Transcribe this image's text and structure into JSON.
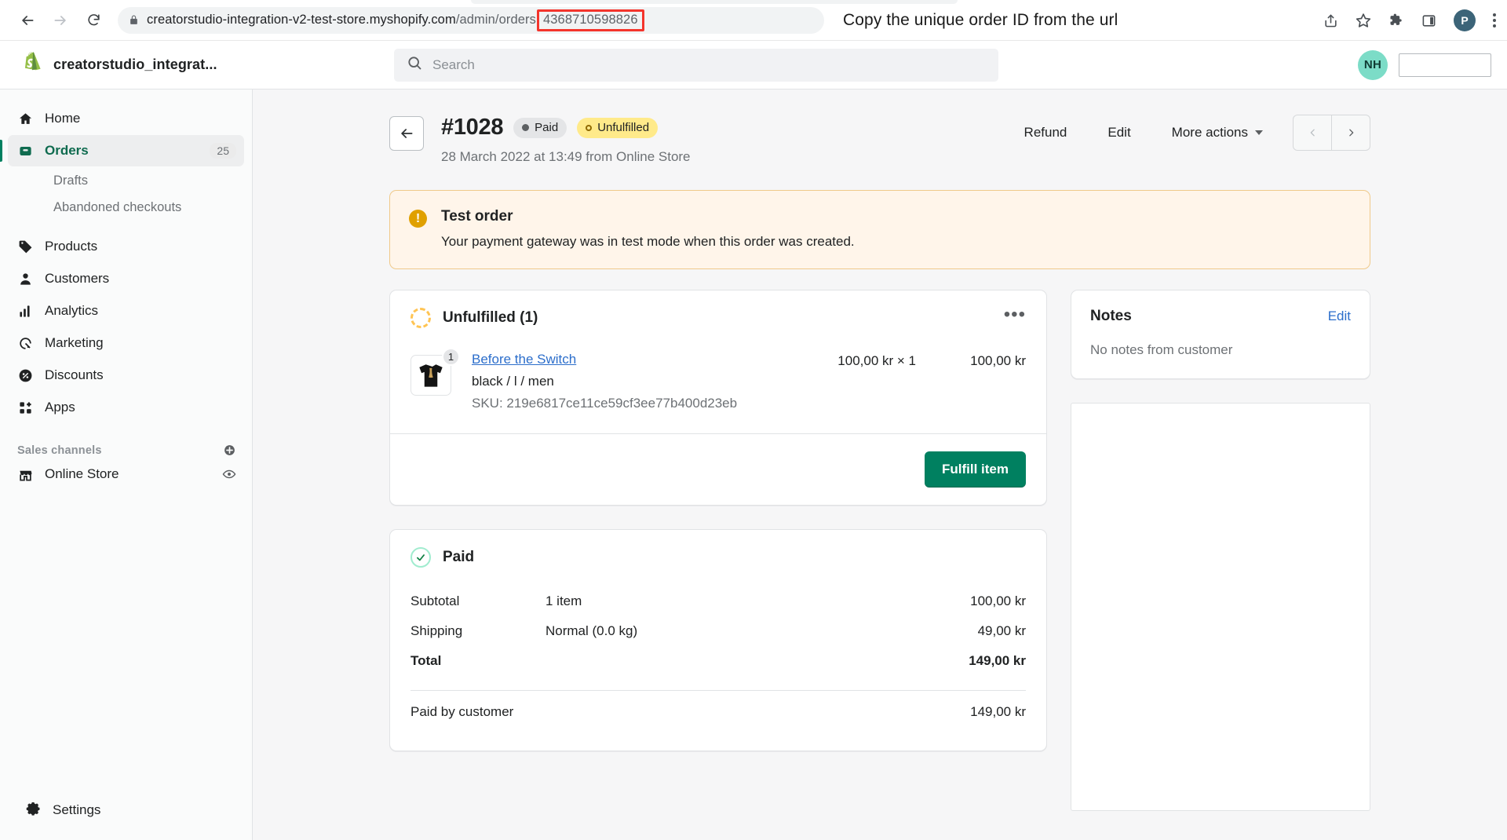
{
  "browser": {
    "back_icon": "back-arrow-icon",
    "forward_icon": "forward-arrow-icon",
    "reload_icon": "reload-icon",
    "lock_icon": "lock-icon",
    "url_prefix": "creatorstudio-integration-v2-test-store.myshopify.com",
    "url_path": "/admin/orders",
    "url_order_id": "4368710598826",
    "annotation": "Copy the unique order ID from the url",
    "highlight_color": "#f4342c",
    "share_icon": "share-icon",
    "bookmark_icon": "star-icon",
    "extensions_icon": "puzzle-icon",
    "sidepanel_icon": "side-panel-icon",
    "profile_initial": "P",
    "menu_icon": "kebab-menu-icon"
  },
  "topbar": {
    "logo": "shopify-logo-icon",
    "store_name": "creatorstudio_integrat...",
    "search_icon": "search-icon",
    "search_placeholder": "Search",
    "search_value": "",
    "user_initials": "NH",
    "user_name": ""
  },
  "sidebar": {
    "items": [
      {
        "label": "Home",
        "icon": "home-icon",
        "badge": "",
        "active": false
      },
      {
        "label": "Orders",
        "icon": "orders-icon",
        "badge": "25",
        "active": true
      },
      {
        "label": "Products",
        "icon": "tag-icon",
        "badge": "",
        "active": false
      },
      {
        "label": "Customers",
        "icon": "person-icon",
        "badge": "",
        "active": false
      },
      {
        "label": "Analytics",
        "icon": "bar-chart-icon",
        "badge": "",
        "active": false
      },
      {
        "label": "Marketing",
        "icon": "megaphone-icon",
        "badge": "",
        "active": false
      },
      {
        "label": "Discounts",
        "icon": "discount-icon",
        "badge": "",
        "active": false
      },
      {
        "label": "Apps",
        "icon": "apps-icon",
        "badge": "",
        "active": false
      }
    ],
    "subitems": [
      {
        "label": "Drafts"
      },
      {
        "label": "Abandoned checkouts"
      }
    ],
    "sales_channels_title": "Sales channels",
    "sales_channels_add_icon": "plus-circle-icon",
    "online_store": {
      "label": "Online Store",
      "icon": "storefront-icon",
      "trailing_icon": "eye-icon"
    },
    "settings": {
      "label": "Settings",
      "icon": "gear-icon"
    }
  },
  "order": {
    "back_icon": "back-arrow-icon",
    "number": "#1028",
    "payment_status": "Paid",
    "fulfillment_status": "Unfulfilled",
    "meta": "28 March 2022 at 13:49 from Online Store",
    "actions": {
      "refund": "Refund",
      "edit": "Edit",
      "more": "More actions",
      "prev_icon": "chevron-left-icon",
      "next_icon": "chevron-right-icon"
    }
  },
  "banner": {
    "icon": "warning-icon",
    "title": "Test order",
    "body": "Your payment gateway was in test mode when this order was created.",
    "background": "#fff5ea",
    "border": "#f0c98a",
    "icon_color": "#e0a000"
  },
  "fulfillment_card": {
    "status_icon": "unfulfilled-ring-icon",
    "title": "Unfulfilled (1)",
    "menu_icon": "more-horizontal-icon",
    "item": {
      "thumbnail": "tshirt-thumbnail",
      "quantity_badge": "1",
      "name": "Before the Switch",
      "variant": "black / l / men",
      "sku": "SKU: 219e6817ce11ce59cf3ee77b400d23eb",
      "unit_price": "100,00 kr × 1",
      "line_total": "100,00 kr"
    },
    "fulfill_button": "Fulfill item",
    "button_color": "#008060"
  },
  "paid_card": {
    "status_icon": "check-circle-icon",
    "title": "Paid",
    "rows": [
      {
        "label": "Subtotal",
        "desc": "1 item",
        "value": "100,00 kr",
        "bold": false
      },
      {
        "label": "Shipping",
        "desc": "Normal (0.0 kg)",
        "value": "49,00 kr",
        "bold": false
      },
      {
        "label": "Total",
        "desc": "",
        "value": "149,00 kr",
        "bold": true
      }
    ],
    "paid_by_customer_label": "Paid by customer",
    "paid_by_customer_value": "149,00 kr"
  },
  "notes_card": {
    "title": "Notes",
    "edit": "Edit",
    "body": "No notes from customer"
  }
}
